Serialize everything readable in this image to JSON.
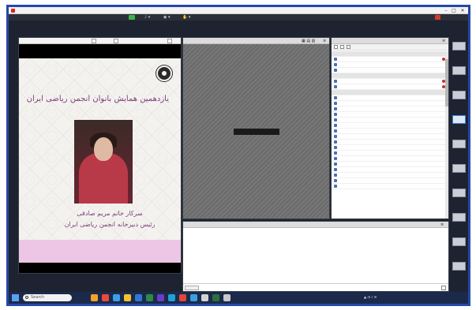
{
  "window": {
    "title": "",
    "controls": [
      "–",
      "□",
      "✕"
    ]
  },
  "toolbar": {
    "items": [
      "",
      "",
      "",
      ""
    ],
    "help_label": ""
  },
  "share_pod": {
    "header_left": "",
    "header_right": ""
  },
  "poster": {
    "headline": "یازدهمین همایش بانوان انجمن ریاضی ایران",
    "name": "سرکار خانم مریم صادقی",
    "role": "رئیس دبیرخانه انجمن ریاضی ایران",
    "band_text": ""
  },
  "video_pod": {
    "title": "",
    "message": ""
  },
  "attendees_pod": {
    "title": "",
    "rows": [
      {
        "type": "group",
        "text": ""
      },
      {
        "type": "person",
        "text": "",
        "flag": true
      },
      {
        "type": "person",
        "text": ""
      },
      {
        "type": "person",
        "text": ""
      },
      {
        "type": "group",
        "text": ""
      },
      {
        "type": "person",
        "text": "",
        "flag": true
      },
      {
        "type": "person",
        "text": "",
        "flag": true
      },
      {
        "type": "group",
        "text": ""
      },
      {
        "type": "person",
        "text": ""
      },
      {
        "type": "person",
        "text": ""
      },
      {
        "type": "person",
        "text": ""
      },
      {
        "type": "person",
        "text": ""
      },
      {
        "type": "person",
        "text": ""
      },
      {
        "type": "person",
        "text": ""
      },
      {
        "type": "person",
        "text": ""
      },
      {
        "type": "person",
        "text": ""
      },
      {
        "type": "person",
        "text": ""
      },
      {
        "type": "person",
        "text": ""
      },
      {
        "type": "person",
        "text": ""
      },
      {
        "type": "person",
        "text": ""
      },
      {
        "type": "person",
        "text": ""
      },
      {
        "type": "person",
        "text": ""
      },
      {
        "type": "person",
        "text": ""
      },
      {
        "type": "person",
        "text": ""
      },
      {
        "type": "person",
        "text": ""
      }
    ]
  },
  "rail": {
    "thumbnails": [
      "",
      "",
      "",
      "",
      "",
      "",
      "",
      "",
      "",
      ""
    ],
    "active_index": 3
  },
  "chat_pod": {
    "title": "",
    "lines": [
      "",
      "",
      "",
      ""
    ]
  },
  "taskbar": {
    "search_placeholder": "Search",
    "clock": "",
    "date": ""
  },
  "colors": {
    "frame_border": "#2548a8",
    "poster_accent": "#7b3e7a",
    "poster_band": "#ecc6e4"
  }
}
